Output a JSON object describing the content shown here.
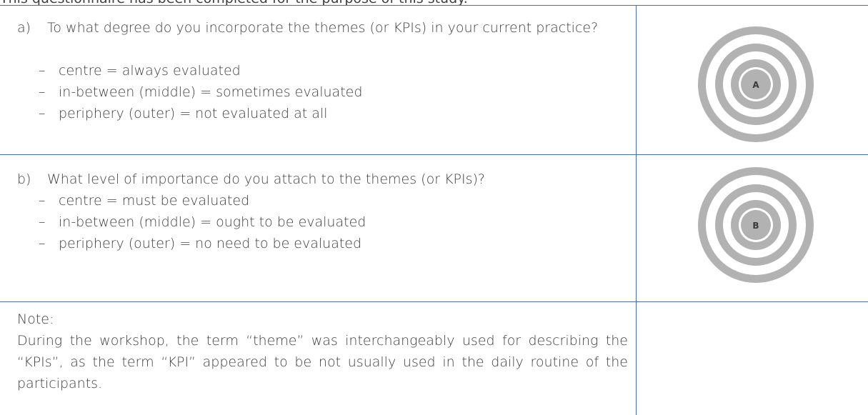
{
  "top_text": "This questionnaire has been completed for the purpose of this study.",
  "questions": [
    {
      "label": "a)",
      "text": "To what degree do you incorporate the themes (or KPIs) in your current practice?",
      "bullets": [
        "centre = always evaluated",
        "in-between (middle) = sometimes evaluated",
        "periphery (outer) = not evaluated at all"
      ],
      "target_letter": "A"
    },
    {
      "label": "b)",
      "text": "What level of importance do you attach to the themes (or KPIs)?",
      "bullets": [
        "centre = must be evaluated",
        "in-between (middle) = ought to be evaluated",
        "periphery (outer) = no need to be evaluated"
      ],
      "target_letter": "B"
    }
  ],
  "note": {
    "title": "Note:",
    "text": "During the workshop, the term “theme” was interchangeably used for describing the “KPIs”, as the term “KPI” appeared to be not usually used in the daily routine of the participants."
  },
  "colors": {
    "rule": "#4a6f9c",
    "target_ring": "#b2b2b2",
    "text": "#3f3f3f"
  }
}
